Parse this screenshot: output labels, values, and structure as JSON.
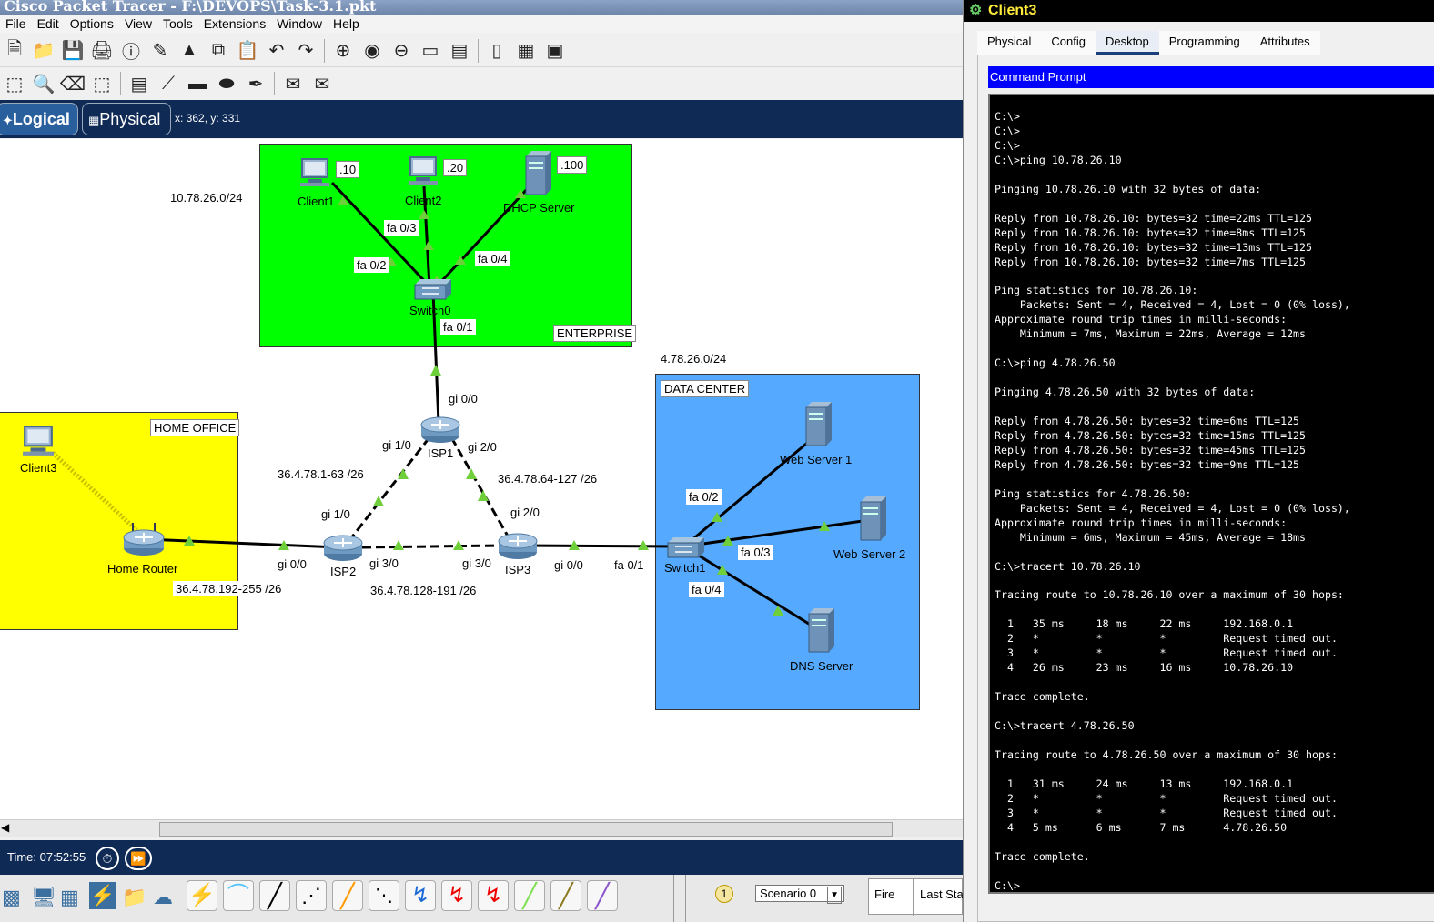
{
  "window": {
    "title": "Cisco Packet Tracer - F:\\DEVOPS\\Task-3.1.pkt",
    "menu": [
      "File",
      "Edit",
      "Options",
      "View",
      "Tools",
      "Extensions",
      "Window",
      "Help"
    ]
  },
  "toolbar1_icons": [
    "new-icon",
    "open-icon",
    "save-icon",
    "print-icon",
    "info-icon",
    "network-wizard-icon",
    "activity-wizard-icon",
    "copy-icon",
    "paste-icon",
    "undo-icon",
    "redo-icon",
    "zoom-in-icon",
    "zoom-reset-icon",
    "zoom-out-icon",
    "drawing-palette-icon",
    "custom-device-icon",
    "pdu-list-icon",
    "tablet-icon",
    "viewport-icon"
  ],
  "toolbar2_icons": [
    "select-icon",
    "inspect-icon",
    "delete-icon",
    "resize-icon",
    "note-icon",
    "line-icon",
    "rectangle-icon",
    "ellipse-icon",
    "freeform-icon",
    "simple-pdu-icon",
    "complex-pdu-icon"
  ],
  "tabs": {
    "logical": "Logical",
    "physical": "Physical"
  },
  "coords": "x: 362, y: 331",
  "topology": {
    "areas": {
      "enterprise": "ENTERPRISE",
      "home_office": "HOME OFFICE",
      "data_center": "DATA CENTER"
    },
    "area_colors": {
      "enterprise": "#00ff00",
      "home_office": "#ffff00",
      "data_center": "#55aaff"
    },
    "devices": {
      "client1": "Client1",
      "client2": "Client2",
      "dhcp_server": "DHCP Server",
      "switch0": "Switch0",
      "isp1": "ISP1",
      "isp2": "ISP2",
      "isp3": "ISP3",
      "client3": "Client3",
      "home_router": "Home Router",
      "switch1": "Switch1",
      "web_server1": "Web Server 1",
      "web_server2": "Web Server 2",
      "dns_server": "DNS Server"
    },
    "host_tags": {
      "client1": ".10",
      "client2": ".20",
      "dhcp": ".100"
    },
    "networks": {
      "enterprise_net": "10.78.26.0/24",
      "dc_net": "4.78.26.0/24",
      "isp1_isp2": "36.4.78.1-63 /26",
      "isp1_isp3": "36.4.78.64-127 /26",
      "isp2_isp3": "36.4.78.128-191 /26",
      "home_isp2": "36.4.78.192-255 /26"
    },
    "ports": {
      "sw0_client2": "fa 0/3",
      "sw0_client1": "fa 0/2",
      "sw0_dhcp": "fa 0/4",
      "sw0_isp1": "fa 0/1",
      "isp1_sw0": "gi 0/0",
      "isp1_isp2": "gi 1/0",
      "isp1_isp3": "gi 2/0",
      "isp2_isp1": "gi 1/0",
      "isp2_home": "gi 0/0",
      "isp2_isp3": "gi 3/0",
      "isp3_isp2": "gi 3/0",
      "isp3_isp1": "gi 2/0",
      "isp3_sw1": "gi 0/0",
      "sw1_isp3": "fa 0/1",
      "sw1_web1": "fa 0/2",
      "sw1_web2": "fa 0/3",
      "sw1_dns": "fa 0/4"
    }
  },
  "timebar": {
    "time": "Time: 07:52:55"
  },
  "bottom": {
    "scenario": "Scenario 0",
    "fire": "Fire",
    "last_status": "Last Sta"
  },
  "side": {
    "title": "Client3",
    "tabs": [
      "Physical",
      "Config",
      "Desktop",
      "Programming",
      "Attributes"
    ],
    "active_tab": "Desktop",
    "cmd_title": "Command Prompt",
    "terminal": "C:\\>\nC:\\>\nC:\\>\nC:\\>ping 10.78.26.10\n\nPinging 10.78.26.10 with 32 bytes of data:\n\nReply from 10.78.26.10: bytes=32 time=22ms TTL=125\nReply from 10.78.26.10: bytes=32 time=8ms TTL=125\nReply from 10.78.26.10: bytes=32 time=13ms TTL=125\nReply from 10.78.26.10: bytes=32 time=7ms TTL=125\n\nPing statistics for 10.78.26.10:\n    Packets: Sent = 4, Received = 4, Lost = 0 (0% loss),\nApproximate round trip times in milli-seconds:\n    Minimum = 7ms, Maximum = 22ms, Average = 12ms\n\nC:\\>ping 4.78.26.50\n\nPinging 4.78.26.50 with 32 bytes of data:\n\nReply from 4.78.26.50: bytes=32 time=6ms TTL=125\nReply from 4.78.26.50: bytes=32 time=15ms TTL=125\nReply from 4.78.26.50: bytes=32 time=45ms TTL=125\nReply from 4.78.26.50: bytes=32 time=9ms TTL=125\n\nPing statistics for 4.78.26.50:\n    Packets: Sent = 4, Received = 4, Lost = 0 (0% loss),\nApproximate round trip times in milli-seconds:\n    Minimum = 6ms, Maximum = 45ms, Average = 18ms\n\nC:\\>tracert 10.78.26.10\n\nTracing route to 10.78.26.10 over a maximum of 30 hops:\n\n  1   35 ms     18 ms     22 ms     192.168.0.1\n  2   *         *         *         Request timed out.\n  3   *         *         *         Request timed out.\n  4   26 ms     23 ms     16 ms     10.78.26.10\n\nTrace complete.\n\nC:\\>tracert 4.78.26.50\n\nTracing route to 4.78.26.50 over a maximum of 30 hops:\n\n  1   31 ms     24 ms     13 ms     192.168.0.1\n  2   *         *         *         Request timed out.\n  3   *         *         *         Request timed out.\n  4   5 ms      6 ms      7 ms      4.78.26.50\n\nTrace complete.\n\nC:\\>"
  }
}
